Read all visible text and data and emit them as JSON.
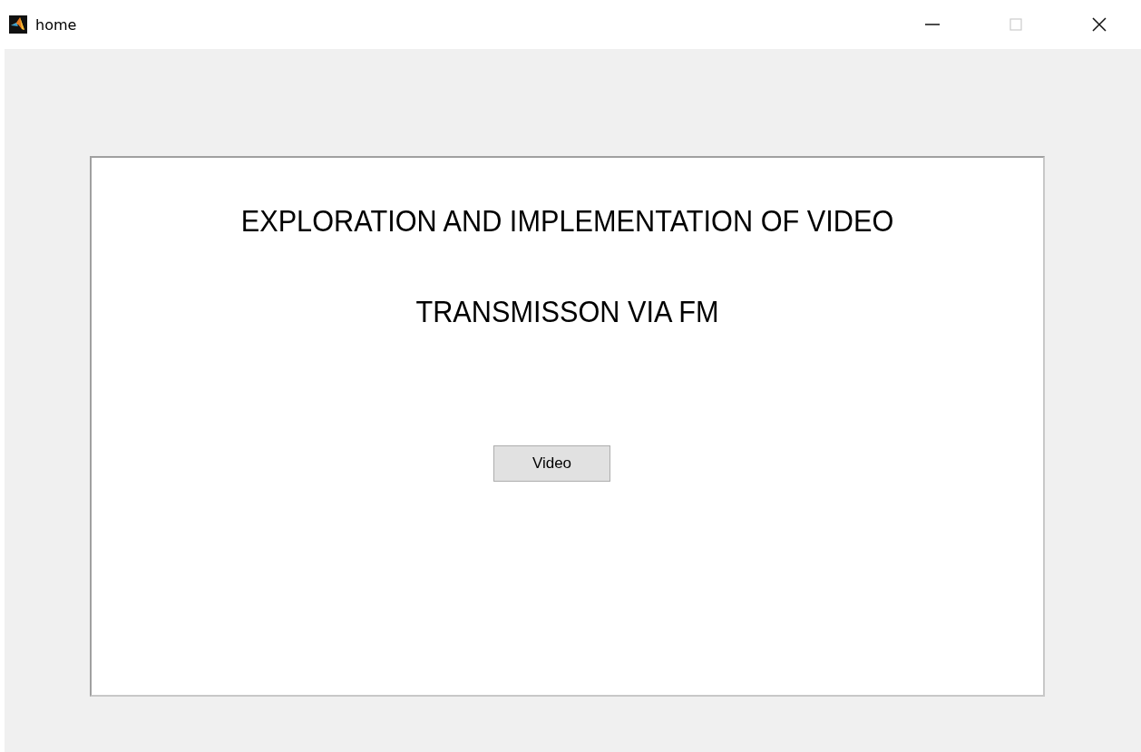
{
  "window": {
    "title": "home",
    "controls": [
      {
        "kind": "minimize",
        "disabled": false
      },
      {
        "kind": "maximize",
        "disabled": true
      },
      {
        "kind": "close",
        "disabled": false
      }
    ]
  },
  "panel": {
    "heading_lines": [
      "EXPLORATION AND IMPLEMENTATION OF VIDEO",
      "TRANSMISSON VIA FM"
    ],
    "buttons": [
      {
        "label": "Video"
      }
    ]
  }
}
